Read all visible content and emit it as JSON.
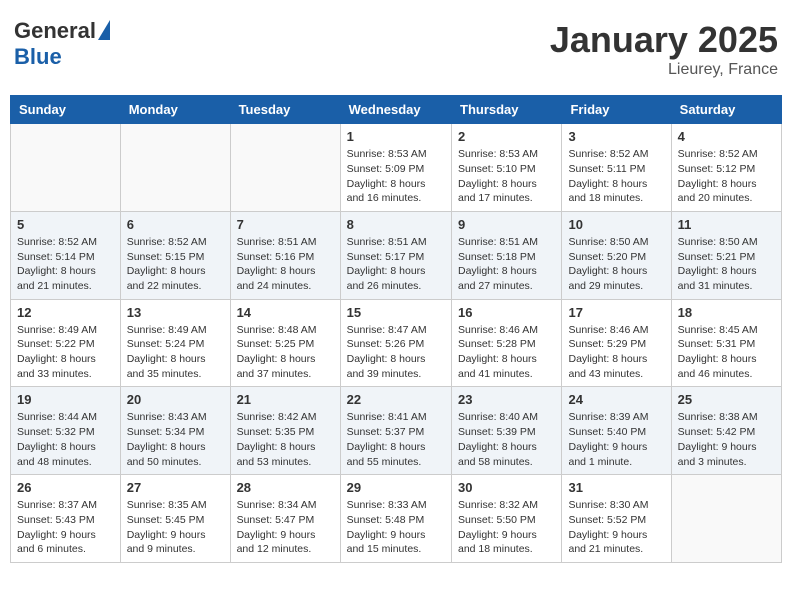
{
  "header": {
    "logo_general": "General",
    "logo_blue": "Blue",
    "month": "January 2025",
    "location": "Lieurey, France"
  },
  "days_of_week": [
    "Sunday",
    "Monday",
    "Tuesday",
    "Wednesday",
    "Thursday",
    "Friday",
    "Saturday"
  ],
  "weeks": [
    [
      {
        "day": "",
        "info": ""
      },
      {
        "day": "",
        "info": ""
      },
      {
        "day": "",
        "info": ""
      },
      {
        "day": "1",
        "info": "Sunrise: 8:53 AM\nSunset: 5:09 PM\nDaylight: 8 hours\nand 16 minutes."
      },
      {
        "day": "2",
        "info": "Sunrise: 8:53 AM\nSunset: 5:10 PM\nDaylight: 8 hours\nand 17 minutes."
      },
      {
        "day": "3",
        "info": "Sunrise: 8:52 AM\nSunset: 5:11 PM\nDaylight: 8 hours\nand 18 minutes."
      },
      {
        "day": "4",
        "info": "Sunrise: 8:52 AM\nSunset: 5:12 PM\nDaylight: 8 hours\nand 20 minutes."
      }
    ],
    [
      {
        "day": "5",
        "info": "Sunrise: 8:52 AM\nSunset: 5:14 PM\nDaylight: 8 hours\nand 21 minutes."
      },
      {
        "day": "6",
        "info": "Sunrise: 8:52 AM\nSunset: 5:15 PM\nDaylight: 8 hours\nand 22 minutes."
      },
      {
        "day": "7",
        "info": "Sunrise: 8:51 AM\nSunset: 5:16 PM\nDaylight: 8 hours\nand 24 minutes."
      },
      {
        "day": "8",
        "info": "Sunrise: 8:51 AM\nSunset: 5:17 PM\nDaylight: 8 hours\nand 26 minutes."
      },
      {
        "day": "9",
        "info": "Sunrise: 8:51 AM\nSunset: 5:18 PM\nDaylight: 8 hours\nand 27 minutes."
      },
      {
        "day": "10",
        "info": "Sunrise: 8:50 AM\nSunset: 5:20 PM\nDaylight: 8 hours\nand 29 minutes."
      },
      {
        "day": "11",
        "info": "Sunrise: 8:50 AM\nSunset: 5:21 PM\nDaylight: 8 hours\nand 31 minutes."
      }
    ],
    [
      {
        "day": "12",
        "info": "Sunrise: 8:49 AM\nSunset: 5:22 PM\nDaylight: 8 hours\nand 33 minutes."
      },
      {
        "day": "13",
        "info": "Sunrise: 8:49 AM\nSunset: 5:24 PM\nDaylight: 8 hours\nand 35 minutes."
      },
      {
        "day": "14",
        "info": "Sunrise: 8:48 AM\nSunset: 5:25 PM\nDaylight: 8 hours\nand 37 minutes."
      },
      {
        "day": "15",
        "info": "Sunrise: 8:47 AM\nSunset: 5:26 PM\nDaylight: 8 hours\nand 39 minutes."
      },
      {
        "day": "16",
        "info": "Sunrise: 8:46 AM\nSunset: 5:28 PM\nDaylight: 8 hours\nand 41 minutes."
      },
      {
        "day": "17",
        "info": "Sunrise: 8:46 AM\nSunset: 5:29 PM\nDaylight: 8 hours\nand 43 minutes."
      },
      {
        "day": "18",
        "info": "Sunrise: 8:45 AM\nSunset: 5:31 PM\nDaylight: 8 hours\nand 46 minutes."
      }
    ],
    [
      {
        "day": "19",
        "info": "Sunrise: 8:44 AM\nSunset: 5:32 PM\nDaylight: 8 hours\nand 48 minutes."
      },
      {
        "day": "20",
        "info": "Sunrise: 8:43 AM\nSunset: 5:34 PM\nDaylight: 8 hours\nand 50 minutes."
      },
      {
        "day": "21",
        "info": "Sunrise: 8:42 AM\nSunset: 5:35 PM\nDaylight: 8 hours\nand 53 minutes."
      },
      {
        "day": "22",
        "info": "Sunrise: 8:41 AM\nSunset: 5:37 PM\nDaylight: 8 hours\nand 55 minutes."
      },
      {
        "day": "23",
        "info": "Sunrise: 8:40 AM\nSunset: 5:39 PM\nDaylight: 8 hours\nand 58 minutes."
      },
      {
        "day": "24",
        "info": "Sunrise: 8:39 AM\nSunset: 5:40 PM\nDaylight: 9 hours\nand 1 minute."
      },
      {
        "day": "25",
        "info": "Sunrise: 8:38 AM\nSunset: 5:42 PM\nDaylight: 9 hours\nand 3 minutes."
      }
    ],
    [
      {
        "day": "26",
        "info": "Sunrise: 8:37 AM\nSunset: 5:43 PM\nDaylight: 9 hours\nand 6 minutes."
      },
      {
        "day": "27",
        "info": "Sunrise: 8:35 AM\nSunset: 5:45 PM\nDaylight: 9 hours\nand 9 minutes."
      },
      {
        "day": "28",
        "info": "Sunrise: 8:34 AM\nSunset: 5:47 PM\nDaylight: 9 hours\nand 12 minutes."
      },
      {
        "day": "29",
        "info": "Sunrise: 8:33 AM\nSunset: 5:48 PM\nDaylight: 9 hours\nand 15 minutes."
      },
      {
        "day": "30",
        "info": "Sunrise: 8:32 AM\nSunset: 5:50 PM\nDaylight: 9 hours\nand 18 minutes."
      },
      {
        "day": "31",
        "info": "Sunrise: 8:30 AM\nSunset: 5:52 PM\nDaylight: 9 hours\nand 21 minutes."
      },
      {
        "day": "",
        "info": ""
      }
    ]
  ]
}
